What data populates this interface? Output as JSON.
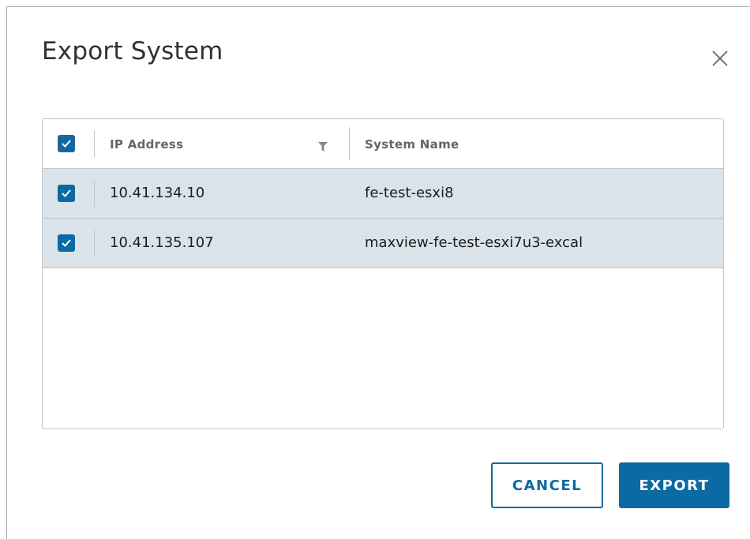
{
  "dialog": {
    "title": "Export System",
    "close_icon": "close-icon"
  },
  "table": {
    "header": {
      "select_all_checked": true,
      "columns": [
        "IP Address",
        "System Name"
      ],
      "filter_icon": "filter-icon"
    },
    "rows": [
      {
        "checked": true,
        "ip": "10.41.134.10",
        "name": "fe-test-esxi8"
      },
      {
        "checked": true,
        "ip": "10.41.135.107",
        "name": "maxview-fe-test-esxi7u3-excal"
      }
    ]
  },
  "buttons": {
    "cancel": "CANCEL",
    "export": "EXPORT"
  },
  "colors": {
    "accent": "#0b6aa2",
    "row_selected": "#dbe3ea"
  }
}
